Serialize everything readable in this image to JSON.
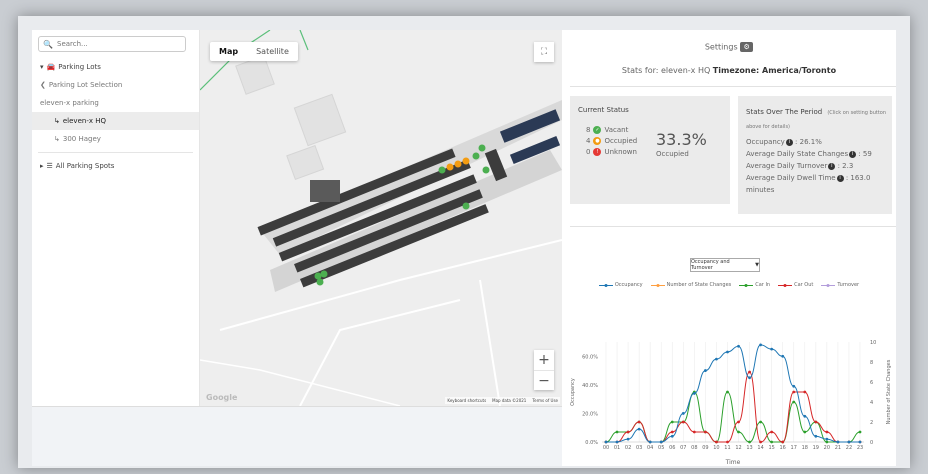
{
  "sidebar": {
    "search_placeholder": "Search...",
    "items": [
      {
        "label": "Parking Lots"
      },
      {
        "label": "Parking Lot Selection"
      },
      {
        "label": "eleven-x parking"
      },
      {
        "label": "eleven-x HQ"
      },
      {
        "label": "300 Hagey"
      },
      {
        "label": "All Parking Spots"
      }
    ]
  },
  "map": {
    "tabs": [
      "Map",
      "Satellite"
    ],
    "zoom_in": "+",
    "zoom_out": "−",
    "fullscreen_glyph": "⛶",
    "attribution": "Google",
    "footer": [
      "Keyboard shortcuts",
      "Map data ©2021",
      "Terms of Use"
    ]
  },
  "settings": {
    "label": "Settings"
  },
  "stats_for": {
    "prefix": "Stats for: eleven-x HQ ",
    "timezone": "Timezone: America/Toronto"
  },
  "current_status": {
    "title": "Current Status",
    "rows": [
      {
        "count": "8",
        "label": "Vacant",
        "color": "#4caf50"
      },
      {
        "count": "4",
        "label": "Occupied",
        "color": "#f39c12"
      },
      {
        "count": "0",
        "label": "Unknown",
        "color": "#e53935"
      }
    ],
    "percent": "33.3%",
    "percent_label": "Occupied"
  },
  "stats_period": {
    "title": "Stats Over The Period",
    "title_note": "(Click on setting button above for details)",
    "rows": [
      {
        "label": "Occupancy",
        "value": ": 26.1%"
      },
      {
        "label": "Average Daily State Changes",
        "value": ": 59"
      },
      {
        "label": "Average Daily Turnover",
        "value": ": 2.3"
      },
      {
        "label": "Average Daily Dwell Time",
        "value": ": 163.0"
      }
    ],
    "dwell_unit": "minutes"
  },
  "chart_select": {
    "value": "Occupancy and Turnover"
  },
  "chart_data": {
    "type": "line",
    "xlabel": "Time",
    "ylabel": "Occupancy",
    "y2label": "Number of State Changes",
    "categories": [
      "00",
      "01",
      "02",
      "03",
      "04",
      "05",
      "06",
      "07",
      "08",
      "09",
      "10",
      "11",
      "12",
      "13",
      "14",
      "15",
      "16",
      "17",
      "18",
      "19",
      "20",
      "21",
      "22",
      "23"
    ],
    "ylim": [
      0,
      70
    ],
    "y_ticks": [
      "0.0%",
      "20.0%",
      "40.0%",
      "60.0%"
    ],
    "y2lim": [
      0,
      10
    ],
    "y2_ticks": [
      "0",
      "2",
      "4",
      "6",
      "8",
      "10"
    ],
    "series": [
      {
        "name": "Occupancy",
        "color": "#1f77b4",
        "axis": "left",
        "values": [
          0,
          0,
          2,
          9,
          0,
          0,
          4,
          20,
          34,
          50,
          58,
          63,
          67,
          45,
          68,
          65,
          60,
          39,
          18,
          4,
          2,
          0,
          0,
          0
        ]
      },
      {
        "name": "Number of State Changes",
        "color": "#ff9f40",
        "axis": "right",
        "values": [
          0,
          0,
          0,
          0,
          0,
          0,
          0,
          0,
          0,
          0,
          0,
          0,
          0,
          0,
          0,
          0,
          0,
          0,
          0,
          0,
          0,
          0,
          0,
          0
        ]
      },
      {
        "name": "Car In",
        "color": "#2ca02c",
        "axis": "right",
        "values": [
          0,
          1,
          1,
          2,
          0,
          0,
          2,
          2,
          5,
          1,
          0,
          5,
          1,
          0,
          2,
          0,
          0,
          4,
          1,
          2,
          0,
          0,
          0,
          1
        ]
      },
      {
        "name": "Car Out",
        "color": "#d62728",
        "axis": "right",
        "values": [
          0,
          0,
          1,
          2,
          0,
          0,
          1,
          2,
          1,
          1,
          0,
          0,
          2,
          7,
          0,
          1,
          0,
          5,
          5,
          2,
          1,
          0,
          0,
          0
        ]
      },
      {
        "name": "Turnover",
        "color": "#b39ddb",
        "axis": "right",
        "values": [
          0,
          0,
          0,
          0,
          0,
          0,
          0,
          0,
          0,
          0,
          0,
          0,
          0,
          0,
          0,
          0,
          0,
          0,
          0,
          0,
          0,
          0,
          0,
          0
        ]
      }
    ],
    "grid": true,
    "legend": "top"
  }
}
